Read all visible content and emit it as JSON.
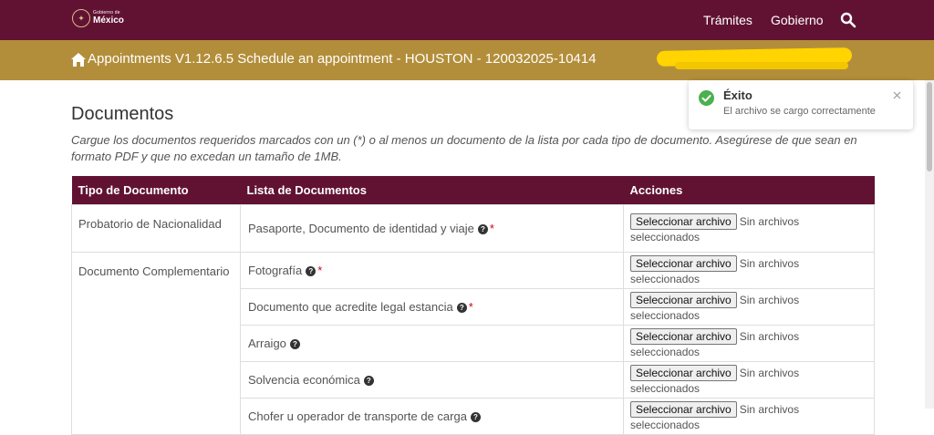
{
  "header": {
    "logo_small": "Gobierno de",
    "logo_big": "México",
    "nav": {
      "tramites": "Trámites",
      "gobierno": "Gobierno"
    },
    "brand_color": "#611232"
  },
  "subheader": {
    "title": "Appointments V1.12.6.5   Schedule an appointment - HOUSTON - 120032025-10414",
    "accent_color": "#b38e3a"
  },
  "main": {
    "title": "Documentos",
    "instructions": "Cargue los documentos requeridos marcados con un (*) o al menos un documento de la lista por cada tipo de documento. Asegúrese de que sean en formato PDF y que no excedan un tamaño de 1MB."
  },
  "table": {
    "headers": [
      "Tipo de Documento",
      "Lista de Documentos",
      "Acciones"
    ],
    "groups": [
      {
        "tipo": "Probatorio de Nacionalidad"
      },
      {
        "tipo": "Documento Complementario"
      }
    ],
    "rows": [
      {
        "doc": "Pasaporte, Documento de identidad y viaje",
        "required": true
      },
      {
        "doc": "Fotografía",
        "required": true
      },
      {
        "doc": "Documento que acredite legal estancia",
        "required": true
      },
      {
        "doc": "Arraigo",
        "required": false
      },
      {
        "doc": "Solvencia económica",
        "required": false
      },
      {
        "doc": "Chofer u operador de transporte de carga",
        "required": false
      }
    ],
    "file_button": "Seleccionar archivo",
    "file_status": "Sin archivos seleccionados",
    "required_mark": "*",
    "help_glyph": "?"
  },
  "toast": {
    "title": "Éxito",
    "message": "El archivo se cargo correctamente",
    "success_color": "#4caf50"
  }
}
